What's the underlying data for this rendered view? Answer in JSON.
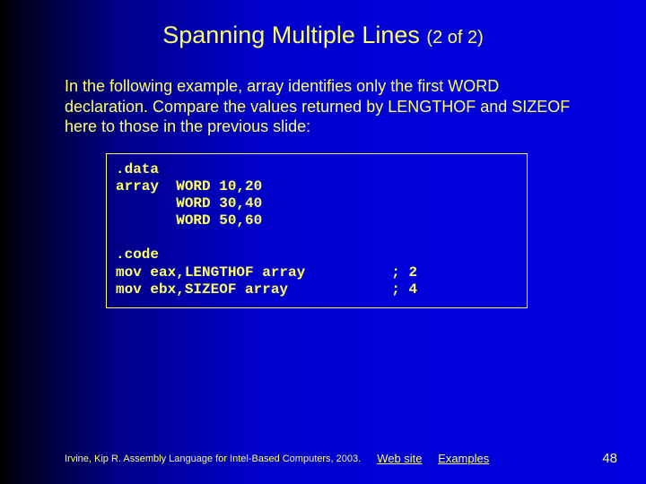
{
  "title": {
    "main": "Spanning Multiple Lines",
    "sub": "(2 of 2)"
  },
  "body": "In the following example, array identifies only the first WORD declaration. Compare the values returned by LENGTHOF and SIZEOF here to those in the previous slide:",
  "code": ".data\narray  WORD 10,20\n       WORD 30,40\n       WORD 50,60\n\n.code\nmov eax,LENGTHOF array          ; 2\nmov ebx,SIZEOF array            ; 4",
  "footer": {
    "citation": "Irvine, Kip R. Assembly Language for Intel-Based Computers, 2003.",
    "link1": "Web site",
    "link2": "Examples",
    "page": "48"
  }
}
